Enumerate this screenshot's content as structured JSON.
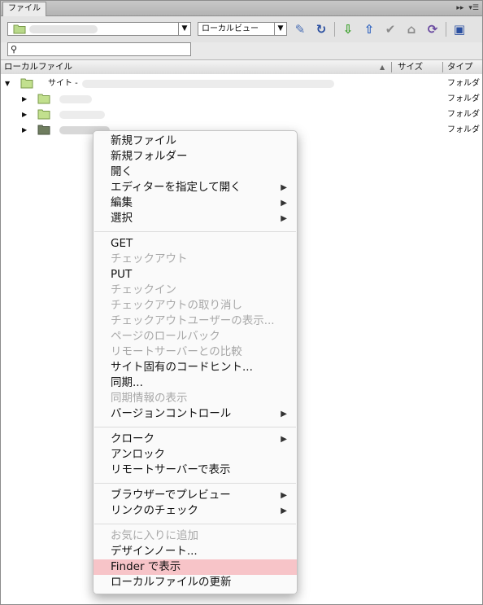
{
  "tab": {
    "label": "ファイル"
  },
  "toolbar": {
    "view_select": "ローカルビュー"
  },
  "search": {
    "placeholder": ""
  },
  "columns": {
    "local_files": "ローカルファイル",
    "size": "サイズ",
    "type": "タイプ"
  },
  "tree": {
    "root_label": "サイト -",
    "rows": [
      {
        "type": "フォルダ"
      },
      {
        "type": "フォルダ"
      },
      {
        "type": "フォルダ"
      },
      {
        "type": "フォルダ"
      }
    ]
  },
  "menu": {
    "items": [
      {
        "label": "新規ファイル"
      },
      {
        "label": "新規フォルダー"
      },
      {
        "label": "開く"
      },
      {
        "label": "エディターを指定して開く"
      },
      {
        "label": "編集"
      },
      {
        "label": "選択"
      },
      {
        "label": "GET"
      },
      {
        "label": "チェックアウト"
      },
      {
        "label": "PUT"
      },
      {
        "label": "チェックイン"
      },
      {
        "label": "チェックアウトの取り消し"
      },
      {
        "label": "チェックアウトユーザーの表示..."
      },
      {
        "label": "ページのロールバック"
      },
      {
        "label": "リモートサーバーとの比較"
      },
      {
        "label": "サイト固有のコードヒント..."
      },
      {
        "label": "同期..."
      },
      {
        "label": "同期情報の表示"
      },
      {
        "label": "バージョンコントロール"
      },
      {
        "label": "クローク"
      },
      {
        "label": "アンロック"
      },
      {
        "label": "リモートサーバーで表示"
      },
      {
        "label": "ブラウザーでプレビュー"
      },
      {
        "label": "リンクのチェック"
      },
      {
        "label": "お気に入りに追加"
      },
      {
        "label": "デザインノート..."
      },
      {
        "label": "Finder で表示"
      },
      {
        "label": "ローカルファイルの更新"
      }
    ]
  }
}
